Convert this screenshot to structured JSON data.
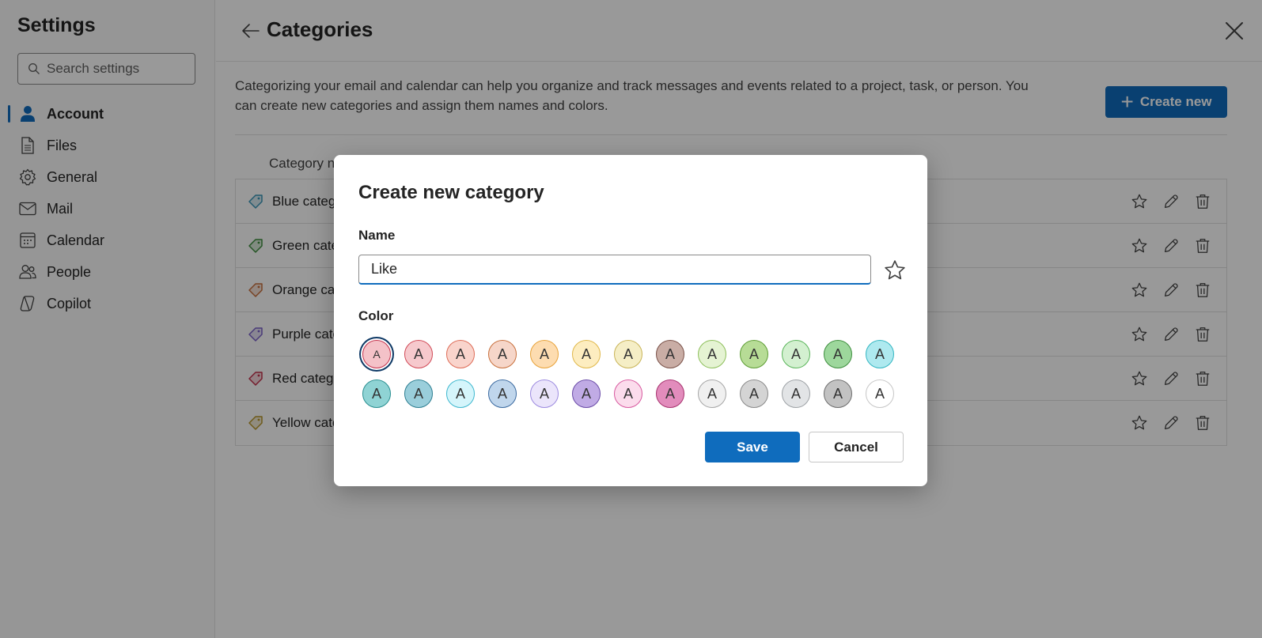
{
  "sidebar": {
    "title": "Settings",
    "search_placeholder": "Search settings",
    "items": [
      {
        "label": "Account",
        "icon": "person-icon",
        "active": true
      },
      {
        "label": "Files",
        "icon": "file-icon"
      },
      {
        "label": "General",
        "icon": "gear-icon"
      },
      {
        "label": "Mail",
        "icon": "mail-icon"
      },
      {
        "label": "Calendar",
        "icon": "calendar-icon"
      },
      {
        "label": "People",
        "icon": "people-icon"
      },
      {
        "label": "Copilot",
        "icon": "copilot-icon"
      }
    ]
  },
  "main": {
    "title": "Categories",
    "description": "Categorizing your email and calendar can help you organize and track messages and events related to a project, task, or person. You can create new categories and assign them names and colors.",
    "create_button": "Create new",
    "column_header": "Category n",
    "categories": [
      {
        "name": "Blue categ",
        "color": "#3a96b8"
      },
      {
        "name": "Green cate",
        "color": "#3e8e3e"
      },
      {
        "name": "Orange ca",
        "color": "#c8703c"
      },
      {
        "name": "Purple cate",
        "color": "#7b61c9"
      },
      {
        "name": "Red categ",
        "color": "#c4314b"
      },
      {
        "name": "Yellow cate",
        "color": "#b8962a"
      }
    ]
  },
  "dialog": {
    "title": "Create new category",
    "name_label": "Name",
    "name_value": "Like",
    "color_label": "Color",
    "swatch_letter": "A",
    "swatch_rows": [
      [
        {
          "bg": "#f4c2c8",
          "border": "#c4314b",
          "selected": true
        },
        {
          "bg": "#f6c9cd",
          "border": "#d14a57"
        },
        {
          "bg": "#f9d4cc",
          "border": "#de6c57"
        },
        {
          "bg": "#f6d6c9",
          "border": "#c8703c"
        },
        {
          "bg": "#fddcb0",
          "border": "#e8a33a"
        },
        {
          "bg": "#fdedc0",
          "border": "#e0b84a"
        },
        {
          "bg": "#f5eec6",
          "border": "#c9b458"
        },
        {
          "bg": "#c9ada5",
          "border": "#7a5148"
        },
        {
          "bg": "#e5f3d3",
          "border": "#8dbf5a"
        },
        {
          "bg": "#b7dc96",
          "border": "#5e9e35"
        },
        {
          "bg": "#d3f0d0",
          "border": "#5bb55b"
        },
        {
          "bg": "#9dd79c",
          "border": "#3e8e3e"
        },
        {
          "bg": "#aee9ef",
          "border": "#33b6c2"
        }
      ],
      [
        {
          "bg": "#8fd3d4",
          "border": "#2a8f91"
        },
        {
          "bg": "#9acedb",
          "border": "#2e7f92"
        },
        {
          "bg": "#d5f5fb",
          "border": "#3fb8cf"
        },
        {
          "bg": "#c0d6ec",
          "border": "#3b6aa0"
        },
        {
          "bg": "#ebe5fb",
          "border": "#9d8be0"
        },
        {
          "bg": "#c0abe5",
          "border": "#6b4ca8"
        },
        {
          "bg": "#fbdcec",
          "border": "#d85aa0"
        },
        {
          "bg": "#e28cbc",
          "border": "#a8336f"
        },
        {
          "bg": "#f0f0f0",
          "border": "#a6a6a6"
        },
        {
          "bg": "#d4d4d4",
          "border": "#8a8a8a"
        },
        {
          "bg": "#e2e4e6",
          "border": "#9ea2a6"
        },
        {
          "bg": "#c2c2c2",
          "border": "#6e6e6e"
        },
        {
          "bg": "#ffffff",
          "border": "#c7c7c7"
        }
      ]
    ],
    "save_label": "Save",
    "cancel_label": "Cancel"
  }
}
